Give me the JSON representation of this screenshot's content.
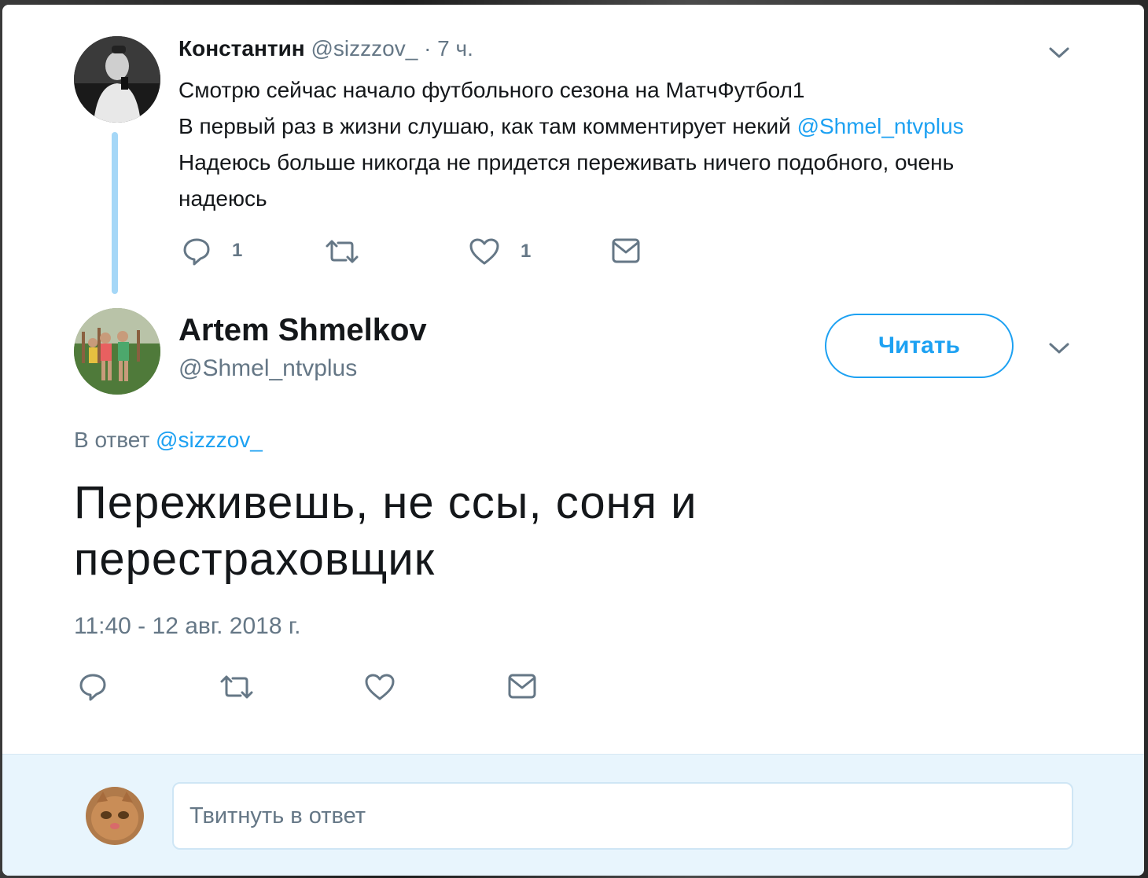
{
  "parent_tweet": {
    "author_name": "Константин",
    "author_handle": "@sizzzov_",
    "time_ago": "· 7 ч.",
    "lines": [
      "Смотрю сейчас начало футбольного сезона на МатчФутбол1",
      "В первый раз в жизни слушаю, как там комментирует некий ",
      "Надеюсь больше никогда не придется переживать ничего подобного, очень",
      "надеюсь"
    ],
    "mention": "@Shmel_ntvplus",
    "reply_count": "1",
    "like_count": "1",
    "icons": [
      "reply-icon",
      "retweet-icon",
      "like-icon",
      "dm-icon",
      "chevron-down-icon"
    ]
  },
  "main_tweet": {
    "author_name": "Artem Shmelkov",
    "author_handle": "@Shmel_ntvplus",
    "follow_label": "Читать",
    "reply_to_prefix": "В ответ ",
    "reply_to_handle": "@sizzzov_",
    "text_lines": [
      "Переживешь, не ссы, соня и",
      "перестраховщик"
    ],
    "timestamp": "11:40 - 12 авг. 2018 г.",
    "icons": [
      "reply-icon",
      "retweet-icon",
      "like-icon",
      "dm-icon",
      "chevron-down-icon"
    ]
  },
  "reply_box": {
    "placeholder": "Твитнуть в ответ"
  },
  "colors": {
    "accent": "#1da1f2",
    "text": "#14171a",
    "secondary": "#657786",
    "thread_line": "#a5d7f7",
    "reply_bg": "#e8f5fd"
  }
}
